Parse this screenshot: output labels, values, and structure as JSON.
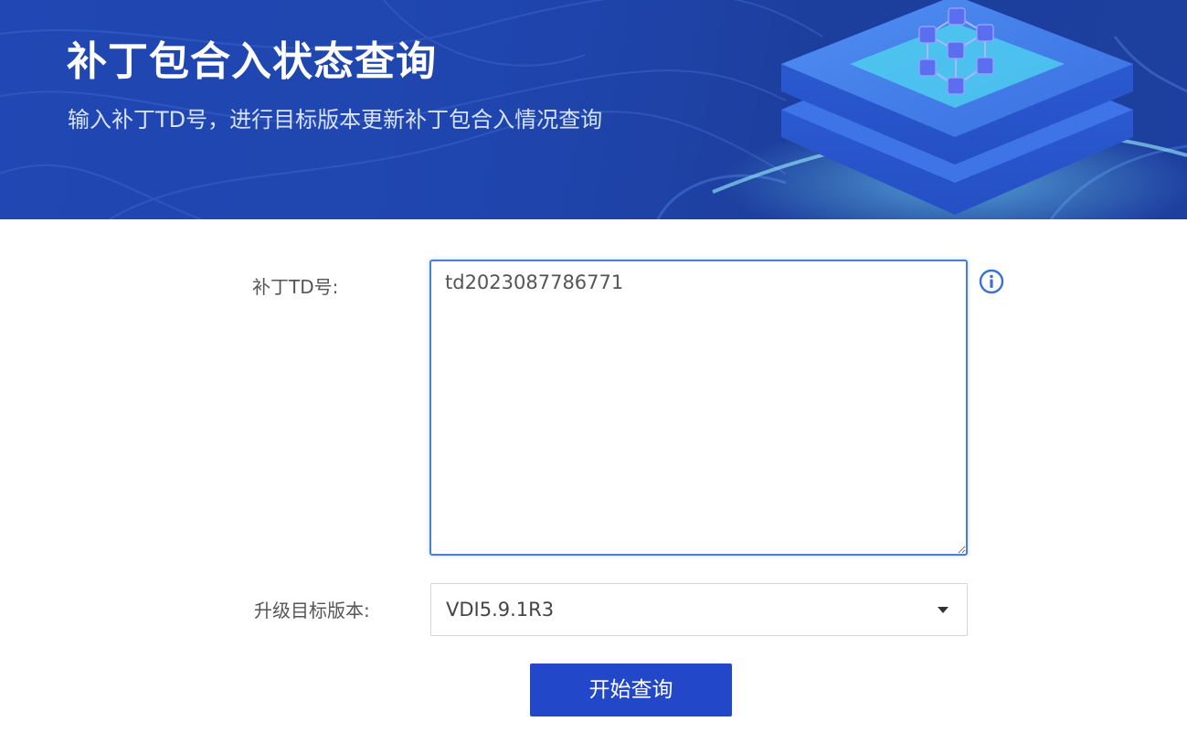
{
  "banner": {
    "title": "补丁包合入状态查询",
    "subtitle": "输入补丁TD号，进行目标版本更新补丁包合入情况查询",
    "illustration_icon": "network-cube-icon"
  },
  "form": {
    "td_label": "补丁TD号:",
    "td_value": "td2023087786771",
    "info_icon": "info-circle-icon",
    "version_label": "升级目标版本:",
    "version_selected": "VDI5.9.1R3",
    "dropdown_icon": "caret-down-icon"
  },
  "actions": {
    "query_button": "开始查询"
  },
  "colors": {
    "banner_primary": "#2147b4",
    "accent": "#2347c9",
    "input_focus_border": "#4a7fd6"
  }
}
